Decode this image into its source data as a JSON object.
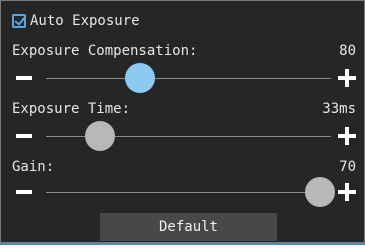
{
  "auto_exposure": {
    "label": "Auto Exposure",
    "checked": true,
    "check_icon": "checkbox-checked-icon"
  },
  "sliders": [
    {
      "label": "Exposure Compensation:",
      "value_text": "80",
      "level": 0.33,
      "active": true
    },
    {
      "label": "Exposure Time:",
      "value_text": "33ms",
      "level": 0.19,
      "active": false
    },
    {
      "label": "Gain:",
      "value_text": "70",
      "level": 0.96,
      "active": false
    }
  ],
  "icons": {
    "decrease": "minus-icon",
    "increase": "plus-icon"
  },
  "default_button": {
    "label": "Default"
  },
  "colors": {
    "panel_bg": "#262626",
    "text": "#e6e6e6",
    "accent": "#58a6e6",
    "active_thumb": "#8ccaf2",
    "thumb": "#b8b8b8",
    "track": "#8a8a8a",
    "button_bg": "#484848"
  }
}
